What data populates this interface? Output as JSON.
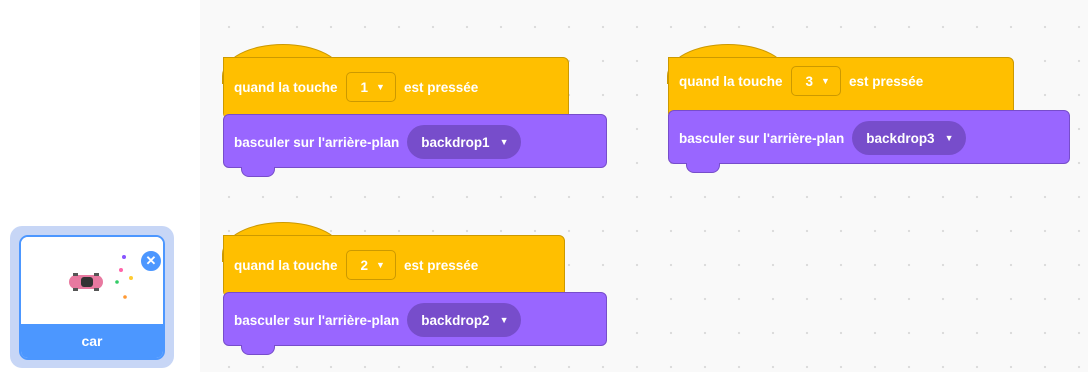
{
  "sprite": {
    "name": "car",
    "delete_icon": "close-icon"
  },
  "colors": {
    "events": "#ffbf00",
    "looks": "#9966ff",
    "selection": "#4c97ff"
  },
  "scripts": [
    {
      "hat_prefix": "quand la touche",
      "key": "1",
      "hat_suffix": "est pressée",
      "action": "basculer sur l'arrière-plan",
      "backdrop": "backdrop1"
    },
    {
      "hat_prefix": "quand la touche",
      "key": "3",
      "hat_suffix": "est pressée",
      "action": "basculer sur l'arrière-plan",
      "backdrop": "backdrop3"
    },
    {
      "hat_prefix": "quand la touche",
      "key": "2",
      "hat_suffix": "est pressée",
      "action": "basculer sur l'arrière-plan",
      "backdrop": "backdrop2"
    }
  ]
}
